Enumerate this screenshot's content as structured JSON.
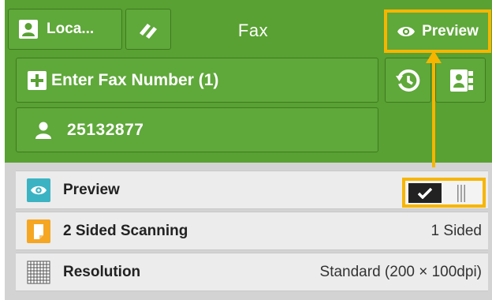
{
  "header": {
    "user_button_label": "Loca...",
    "title": "Fax",
    "preview_button_label": "Preview"
  },
  "recipients": {
    "enter_fax_label": "Enter Fax Number (1)",
    "fax_number": "25132877"
  },
  "settings": {
    "rows": [
      {
        "label": "Preview",
        "value": "",
        "icon": "eye-icon"
      },
      {
        "label": "2 Sided Scanning",
        "value": "1 Sided",
        "icon": "two-sided-scan-icon"
      },
      {
        "label": "Resolution",
        "value": "Standard (200 × 100dpi)",
        "icon": "resolution-grid-icon"
      }
    ]
  },
  "colors": {
    "header_green": "#58a132",
    "highlight_yellow": "#f7b500",
    "preview_icon_teal": "#3bb3c3",
    "two_sided_icon_orange": "#f5a623"
  }
}
